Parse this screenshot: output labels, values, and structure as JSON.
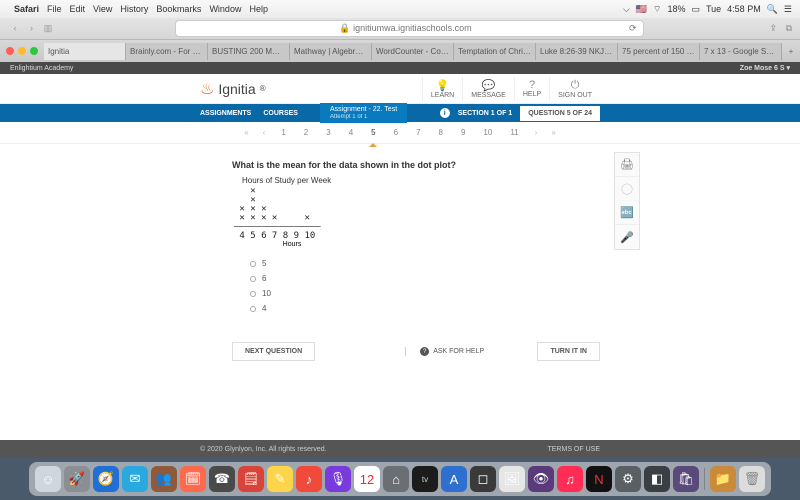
{
  "mac": {
    "app": "Safari",
    "menus": [
      "File",
      "Edit",
      "View",
      "History",
      "Bookmarks",
      "Window",
      "Help"
    ],
    "battery": "18%",
    "day": "Tue",
    "time": "4:58 PM"
  },
  "browser": {
    "address": "ignitiumwa.ignitiaschools.com",
    "tabs": [
      "Ignitia",
      "Brainly.com - For stud…",
      "BUSTING 200 MYTHS…",
      "Mathway | Algebra Pro…",
      "WordCounter - Count…",
      "Temptation of Christ -…",
      "Luke 8:26-39 NKJV -…",
      "75 percent of 150 - Go…",
      "7 x 13 - Google Search"
    ]
  },
  "subbar": {
    "left": "Enlightium Academy",
    "right": "Zoe Mose 6 S ▾"
  },
  "header": {
    "brand": "Ignitia",
    "icons": [
      {
        "glyph": "💡",
        "label": "LEARN"
      },
      {
        "glyph": "💬",
        "label": "MESSAGE"
      },
      {
        "glyph": "?",
        "label": "HELP"
      },
      {
        "glyph": "⏻",
        "label": "SIGN OUT"
      }
    ]
  },
  "bluebar": {
    "links": [
      "ASSIGNMENTS",
      "COURSES"
    ],
    "assignment_title": "Assignment - 22. Test",
    "assignment_sub": "Attempt 1 of 1",
    "section": "SECTION 1 OF 1",
    "question_count": "QUESTION 5 OF 24"
  },
  "qnav": {
    "numbers": [
      "1",
      "2",
      "3",
      "4",
      "5",
      "6",
      "7",
      "8",
      "9",
      "10",
      "11"
    ],
    "current": "5"
  },
  "question": {
    "prompt": "What is the mean for the data shown in the dot plot?",
    "plot_title": "Hours of Study per Week",
    "axis_label": "Hours",
    "options": [
      "5",
      "6",
      "10",
      "4"
    ]
  },
  "chart_data": {
    "type": "dotplot",
    "title": "Hours of Study per Week",
    "xlabel": "Hours",
    "categories": [
      4,
      5,
      6,
      7,
      8,
      9,
      10
    ],
    "values": [
      2,
      4,
      2,
      1,
      0,
      0,
      1
    ]
  },
  "actions": {
    "next": "NEXT QUESTION",
    "ask": "ASK FOR HELP",
    "turnin": "TURN IT IN"
  },
  "footer": {
    "copy": "© 2020 Glynlyon, Inc. All rights reserved.",
    "terms": "TERMS OF USE"
  },
  "dock": [
    {
      "bg": "#cfd6dd",
      "g": "☺"
    },
    {
      "bg": "#8b8f93",
      "g": "🚀"
    },
    {
      "bg": "#1f6fd6",
      "g": "🧭"
    },
    {
      "bg": "#2aa8e0",
      "g": "✉"
    },
    {
      "bg": "#8e5a3b",
      "g": "👥"
    },
    {
      "bg": "#ff6a4d",
      "g": "🗓"
    },
    {
      "bg": "#4a4a4a",
      "g": "☎"
    },
    {
      "bg": "#d8443a",
      "g": "🗒"
    },
    {
      "bg": "#fcd54a",
      "g": "✎"
    },
    {
      "bg": "#f04a3a",
      "g": "♪"
    },
    {
      "bg": "#7a3bdc",
      "g": "🎙"
    },
    {
      "bg": "#ffffff",
      "g": "12",
      "fg": "#d33"
    },
    {
      "bg": "#6b6f73",
      "g": "⌂"
    },
    {
      "bg": "#1c1c1c",
      "g": "tv",
      "fg": "#ccc",
      "fs": "8px"
    },
    {
      "bg": "#2f6fd0",
      "g": "A"
    },
    {
      "bg": "#3a3a3a",
      "g": "◻"
    },
    {
      "bg": "#e6e6e6",
      "g": "🖼"
    },
    {
      "bg": "#5a3a7a",
      "g": "👁"
    },
    {
      "bg": "#ff2d55",
      "g": "♫"
    },
    {
      "bg": "#111",
      "g": "N",
      "fg": "#e33"
    },
    {
      "bg": "#5a5f64",
      "g": "⚙"
    },
    {
      "bg": "#3a3f44",
      "g": "◧"
    },
    {
      "bg": "#5a4a7a",
      "g": "🛍"
    },
    {
      "bg": "#c98a3a",
      "g": "📁"
    },
    {
      "bg": "#dcdcdc",
      "g": "🗑",
      "fg": "#888"
    }
  ]
}
